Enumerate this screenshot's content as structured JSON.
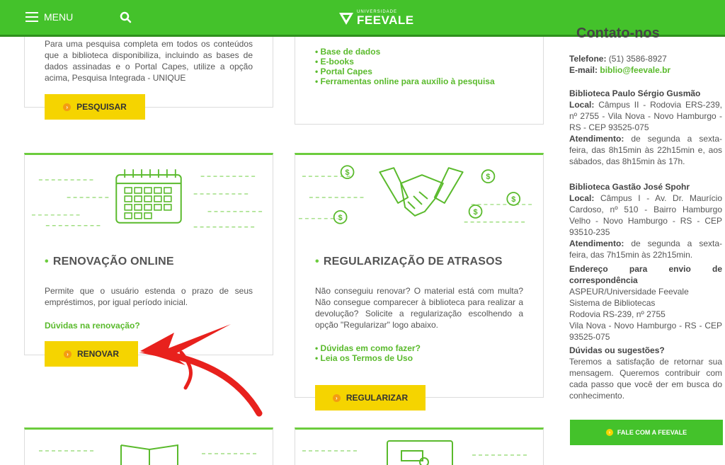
{
  "header": {
    "menu_label": "MENU",
    "logo_small": "UNIVERSIDADE",
    "logo_big": "FEEVALE"
  },
  "search_card": {
    "text": "Para uma pesquisa completa em todos os conteúdos que a biblioteca disponibiliza, incluindo as bases de dados assinadas e o Portal Capes, utilize a opção acima, Pesquisa Integrada - UNIQUE",
    "button": "PESQUISAR"
  },
  "links_card": {
    "items": [
      "Base de dados",
      "E-books",
      "Portal Capes",
      "Ferramentas online para auxílio à pesquisa"
    ]
  },
  "renew_card": {
    "title": "RENOVAÇÃO ONLINE",
    "text": "Permite que o usuário estenda o prazo de seus empréstimos, por igual período inicial.",
    "link": "Dúvidas na renovação?",
    "button": "RENOVAR"
  },
  "overdue_card": {
    "title": "REGULARIZAÇÃO DE ATRASOS",
    "text": "Não conseguiu renovar? O material está com multa? Não consegue comparecer à biblioteca para realizar a devolução? Solicite a regularização escolhendo a opção \"Regularizar\" logo abaixo.",
    "links": [
      "Dúvidas em como fazer?",
      "Leia os Termos de Uso"
    ],
    "button": "REGULARIZAR"
  },
  "sidebar": {
    "title": "Contato-nos",
    "phone_label": "Telefone:",
    "phone": "(51) 3586-8927",
    "email_label": "E-mail:",
    "email": "biblio@feevale.br",
    "lib1_name": "Biblioteca Paulo Sérgio Gusmão",
    "lib1_local_label": "Local:",
    "lib1_local": "Câmpus II - Rodovia ERS-239, nº 2755 - Vila Nova - Novo Hamburgo - RS - CEP 93525-075",
    "lib1_hours_label": "Atendimento:",
    "lib1_hours": "de segunda a sexta-feira, das 8h15min às 22h15min e, aos sábados, das 8h15min às 17h.",
    "lib2_name": "Biblioteca Gastão José Spohr",
    "lib2_local_label": "Local:",
    "lib2_local": "Câmpus I - Av. Dr. Maurício Cardoso, nº 510 - Bairro Hamburgo Velho - Novo Hamburgo - RS - CEP 93510-235",
    "lib2_hours_label": "Atendimento:",
    "lib2_hours": "de segunda a sexta-feira, das 7h15min às 22h15min.",
    "mail_title": "Endereço para envio de correspondência",
    "mail_line1": "ASPEUR/Universidade Feevale",
    "mail_line2": "Sistema de Bibliotecas",
    "mail_line3": "Rodovia RS-239, nº 2755",
    "mail_line4": "Vila Nova - Novo Hamburgo - RS - CEP 93525-075",
    "doubts_title": "Dúvidas ou sugestões?",
    "doubts_text": "Teremos a satisfação de retornar sua mensagem. Queremos contribuir com cada passo que você der em busca do conhecimento.",
    "cta": "FALE COM A FEEVALE"
  },
  "colors": {
    "brand_green": "#44c22b",
    "button_yellow": "#f5d400",
    "arrow_red": "#e8211d"
  }
}
